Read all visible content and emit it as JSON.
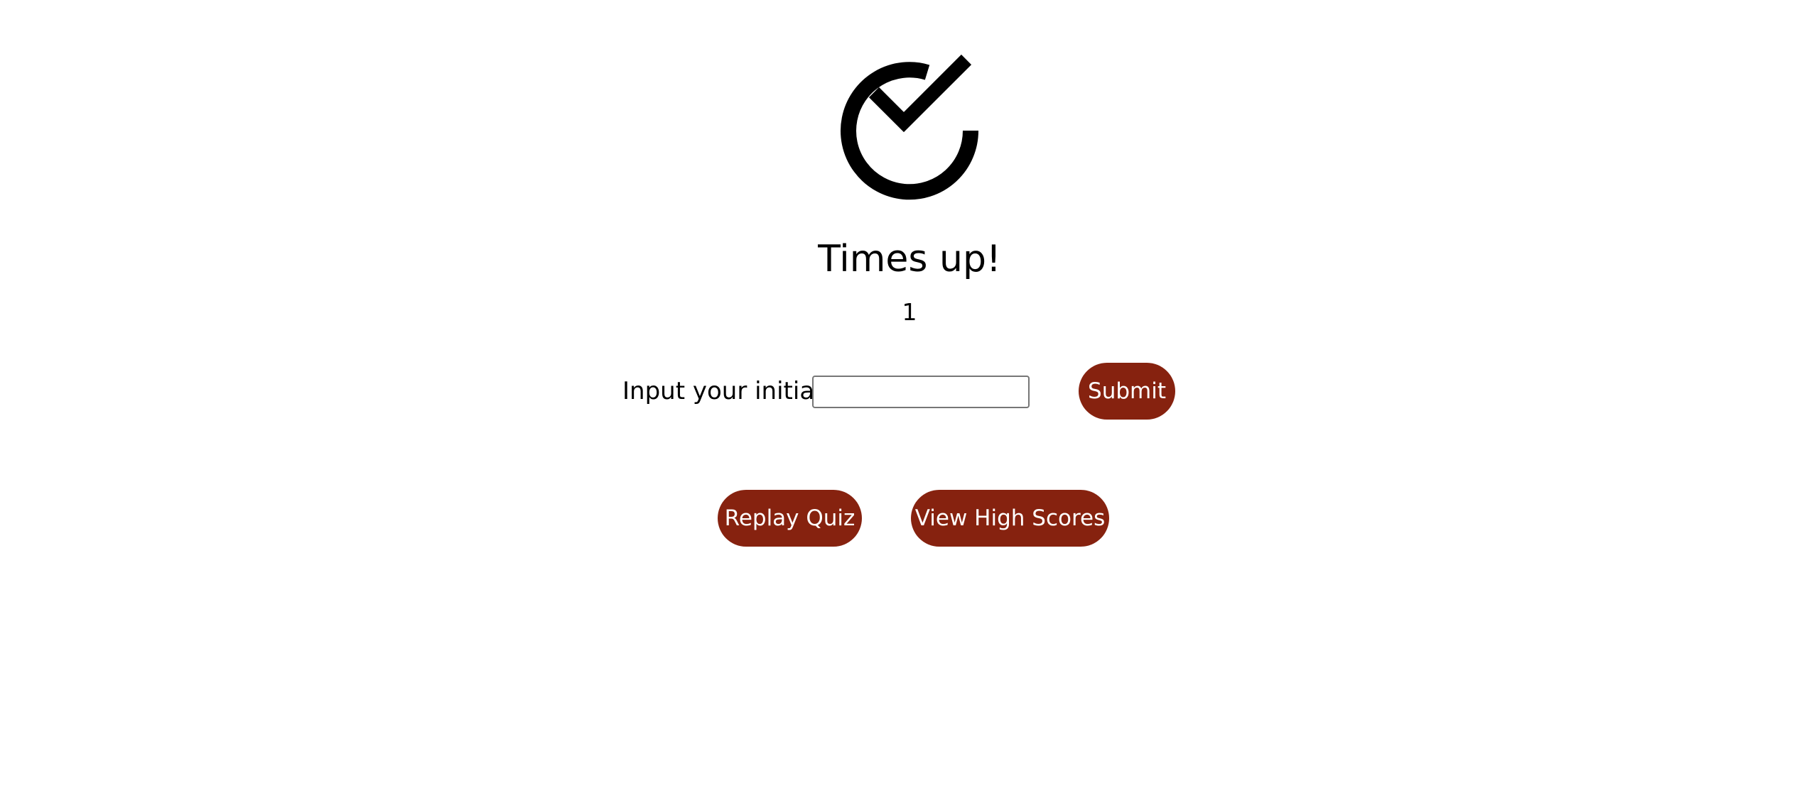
{
  "result": {
    "icon": "check-circle-icon",
    "title": "Times up!",
    "score": "1"
  },
  "initials_form": {
    "label": "Input your initials",
    "input_value": "",
    "input_placeholder": "",
    "submit_label": "Submit"
  },
  "actions": {
    "replay_label": "Replay Quiz",
    "high_scores_label": "View High Scores"
  },
  "colors": {
    "button_background": "#86220f",
    "button_text": "#ffffff",
    "icon": "#000000",
    "background": "#ffffff"
  }
}
